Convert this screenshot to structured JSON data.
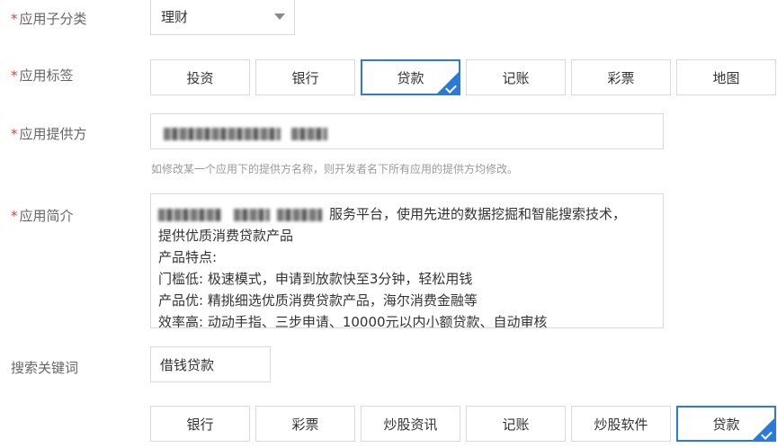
{
  "form": {
    "subcategory": {
      "label": "应用子分类",
      "value": "理财"
    },
    "tags": {
      "label": "应用标签",
      "options": [
        "投资",
        "银行",
        "贷款",
        "记账",
        "彩票",
        "地图"
      ],
      "selected": "贷款"
    },
    "provider": {
      "label": "应用提供方",
      "hint": "如修改某一个应用下的提供方名称，则开发者名下所有应用的提供方均修改。"
    },
    "intro": {
      "label": "应用简介",
      "lines": [
        "服务平台，使用先进的数据挖掘和智能搜索技术，",
        "提供优质消费贷款产品",
        "产品特点:",
        "门槛低: 极速模式，申请到放款快至3分钟，轻松用钱",
        "产品优: 精挑细选优质消费贷款产品，海尔消费金融等",
        "效率高: 动动手指、三步申请、10000元以内小额贷款、自动审核"
      ]
    },
    "keywords": {
      "label": "搜索关键词",
      "value": "借钱贷款",
      "options": [
        "银行",
        "彩票",
        "炒股资讯",
        "记账",
        "炒股软件",
        "贷款"
      ],
      "selected": "贷款"
    }
  },
  "colors": {
    "accent": "#2b7bd6",
    "required": "#e8403a"
  }
}
